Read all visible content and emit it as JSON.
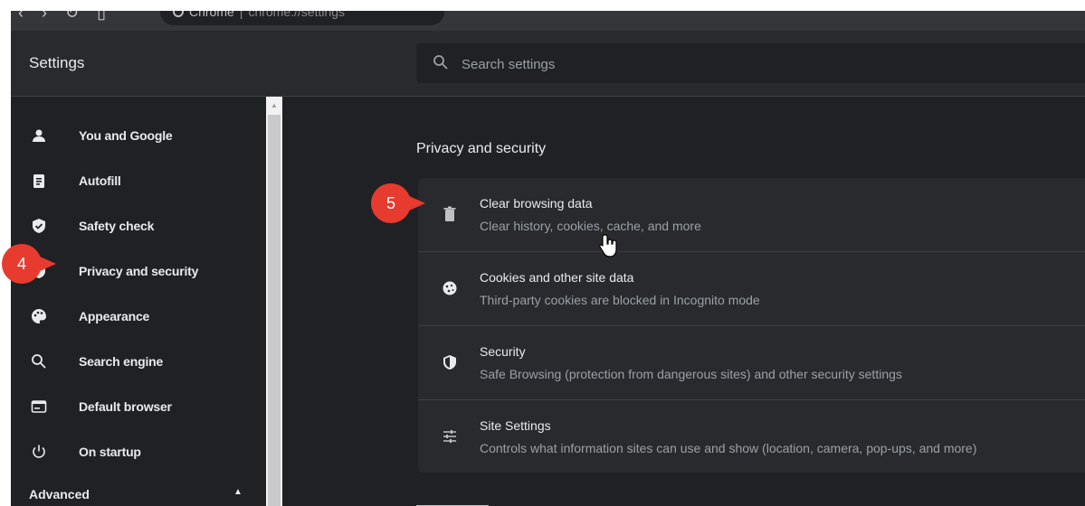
{
  "browser": {
    "omnibox_site": "Chrome",
    "omnibox_separator": "|",
    "omnibox_url": "chrome://settings"
  },
  "header": {
    "title": "Settings",
    "search_placeholder": "Search settings"
  },
  "sidebar": {
    "items": [
      {
        "label": "You and Google",
        "icon": "person-icon"
      },
      {
        "label": "Autofill",
        "icon": "clipboard-icon"
      },
      {
        "label": "Safety check",
        "icon": "shield-check-icon"
      },
      {
        "label": "Privacy and security",
        "icon": "shield-lock-icon"
      },
      {
        "label": "Appearance",
        "icon": "palette-icon"
      },
      {
        "label": "Search engine",
        "icon": "search-icon"
      },
      {
        "label": "Default browser",
        "icon": "browser-window-icon"
      },
      {
        "label": "On startup",
        "icon": "power-icon"
      }
    ],
    "advanced_label": "Advanced"
  },
  "main": {
    "section_title": "Privacy and security",
    "rows": [
      {
        "title": "Clear browsing data",
        "subtitle": "Clear history, cookies, cache, and more",
        "icon": "trash-icon"
      },
      {
        "title": "Cookies and other site data",
        "subtitle": "Third-party cookies are blocked in Incognito mode",
        "icon": "cookie-icon"
      },
      {
        "title": "Security",
        "subtitle": "Safe Browsing (protection from dangerous sites) and other security settings",
        "icon": "shield-lock-icon"
      },
      {
        "title": "Site Settings",
        "subtitle": "Controls what information sites can use and show (location, camera, pop-ups, and more)",
        "icon": "sliders-icon"
      }
    ]
  },
  "callouts": {
    "step4": "4",
    "step5": "5"
  },
  "colors": {
    "background": "#202124",
    "panel": "#292a2d",
    "text": "#e8eaed",
    "secondary_text": "#9aa0a6",
    "callout": "#e63b2e"
  }
}
